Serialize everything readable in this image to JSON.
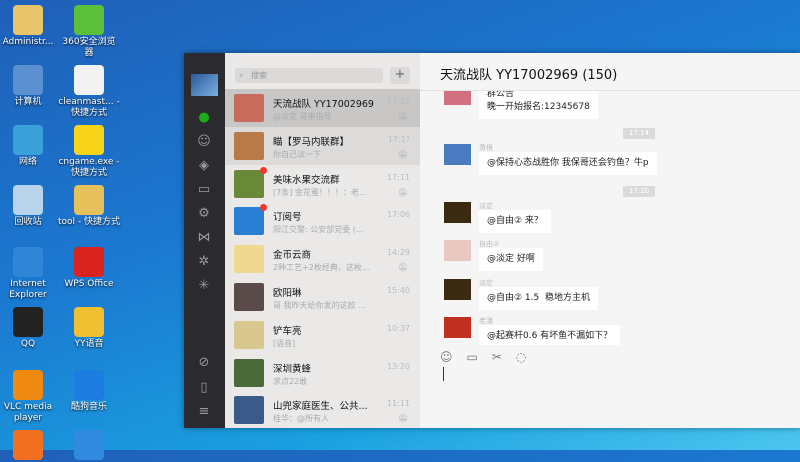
{
  "desktop": {
    "icons": [
      {
        "label": "Administr...",
        "color": "#e8c46a"
      },
      {
        "label": "360安全浏览器",
        "color": "#5bbf3a"
      },
      {
        "label": "计算机",
        "color": "#5a8fd0"
      },
      {
        "label": "cleanmast... - 快捷方式",
        "color": "#f2f2f2"
      },
      {
        "label": "网络",
        "color": "#3aa0d8"
      },
      {
        "label": "cngame.exe - 快捷方式",
        "color": "#f7d31a"
      },
      {
        "label": "回收站",
        "color": "#b8d4ea"
      },
      {
        "label": "tool - 快捷方式",
        "color": "#e6c05a"
      },
      {
        "label": "Internet Explorer",
        "color": "#2f86d6"
      },
      {
        "label": "WPS Office",
        "color": "#d8231f"
      },
      {
        "label": "QQ",
        "color": "#222222"
      },
      {
        "label": "YY语音",
        "color": "#f0c030"
      },
      {
        "label": "VLC media player",
        "color": "#f08a10"
      },
      {
        "label": "酷狗音乐",
        "color": "#1c7ce0"
      },
      {
        "label": "",
        "color": "#f07020"
      },
      {
        "label": "",
        "color": "#2f8ae0"
      }
    ]
  },
  "wechat": {
    "search_placeholder": "搜索",
    "add_label": "+",
    "sidebar_icons": [
      "chat-icon",
      "contacts-icon",
      "box-icon",
      "folder-icon",
      "gear-icon",
      "butterfly-icon",
      "settings-icon",
      "sparkle-icon",
      "mini-program-icon",
      "phone-icon",
      "menu-icon"
    ],
    "chats": [
      {
        "name": "天流战队 YY17002969",
        "preview": "@淡定 哥来指导",
        "time": "17:25",
        "muted": true,
        "color": "#c96b5a"
      },
      {
        "name": "瞄【罗马内联群】",
        "preview": "你自己试一下",
        "time": "17:1?",
        "muted": true,
        "color": "#b97a4a"
      },
      {
        "name": "美味水果交流群",
        "preview": "[7条] 金花蜜！！！：老...",
        "time": "17:11",
        "muted": true,
        "unread": true,
        "color": "#6a8a3a"
      },
      {
        "name": "订阅号",
        "preview": "阳江交警: 公安部党委 (...",
        "time": "17:06",
        "unread": true,
        "color": "#2a7fd4"
      },
      {
        "name": "金币云商",
        "preview": "2种工艺+2枚经典，这枚...",
        "time": "14:29",
        "muted": true,
        "color": "#f0d890"
      },
      {
        "name": "欧阳琳",
        "preview": "哥 我昨天给你发的这款 ...",
        "time": "15:40",
        "color": "#5a4a4a"
      },
      {
        "name": "铲车亮",
        "preview": "[语音]",
        "time": "10:37",
        "color": "#d8c890"
      },
      {
        "name": "深圳黄蜂",
        "preview": "求点22敢",
        "time": "13:20",
        "color": "#4a6a3a"
      },
      {
        "name": "山兜家庭医生、公共...",
        "preview": "桂华：@所有人",
        "time": "11:11",
        "muted": true,
        "color": "#3a5a8a"
      }
    ],
    "chat_title": "天流战队 YY17002969 (150)",
    "messages": [
      {
        "type": "msg",
        "name": "",
        "text": "群公告\n晚一开始报名:12345678",
        "color": "#d07080"
      },
      {
        "type": "time",
        "text": "17:14"
      },
      {
        "type": "msg",
        "name": "萧根",
        "text": "@保持心态战胜你 我保哥还会钓鱼？牛p",
        "color": "#4a7ac0"
      },
      {
        "type": "time",
        "text": "17:20"
      },
      {
        "type": "msg",
        "name": "淡定",
        "text": "@自由② 来？",
        "color": "#3a2a10"
      },
      {
        "type": "msg",
        "name": "自由②",
        "text": "@淡定 好啊",
        "color": "#e8c8c0"
      },
      {
        "type": "msg",
        "name": "淡定",
        "text": "@自由② 1.5  稳地方主机",
        "color": "#3a2a10"
      },
      {
        "type": "msg",
        "name": "老潘",
        "text": "@起赛杆0.6 有坏鱼不漏如下？",
        "color": "#c03020"
      }
    ],
    "input_tools": [
      "emoji-icon",
      "folder-icon",
      "scissors-icon",
      "chat-bubble-icon"
    ]
  }
}
